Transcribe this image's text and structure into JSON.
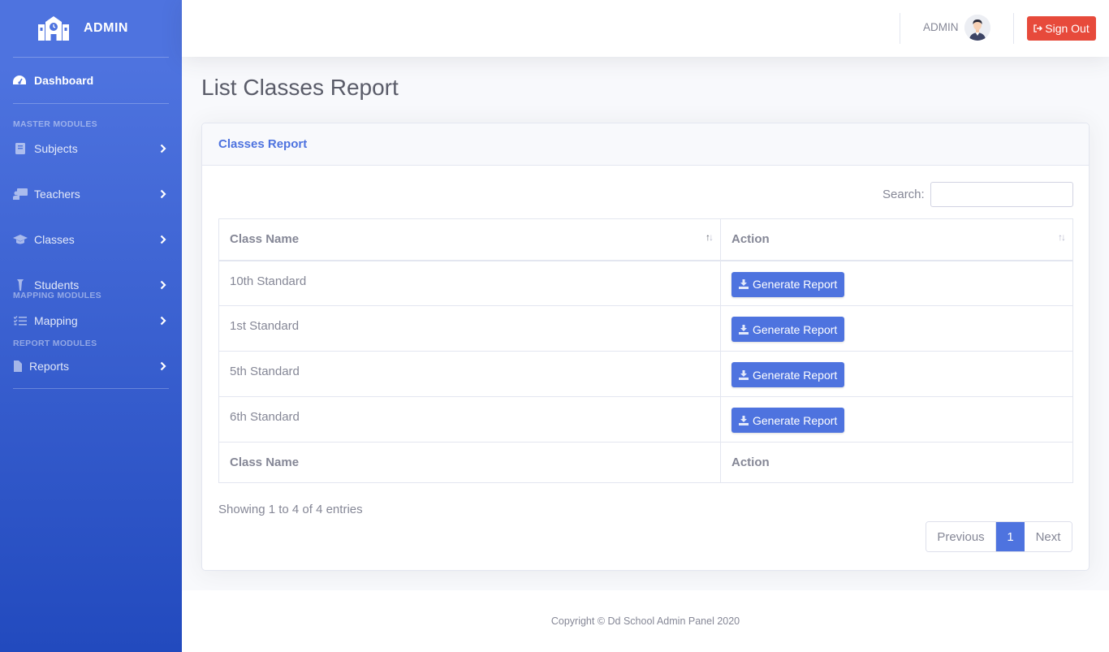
{
  "sidebar": {
    "brand": "ADMIN",
    "dashboard": "Dashboard",
    "sections": {
      "master": "MASTER MODULES",
      "mapping": "MAPPING MODULES",
      "report": "REPORT MODULES"
    },
    "items": [
      {
        "label": "Subjects",
        "icon": "book-icon"
      },
      {
        "label": "Teachers",
        "icon": "chalkboard-teacher-icon"
      },
      {
        "label": "Classes",
        "icon": "graduation-cap-icon"
      },
      {
        "label": "Students",
        "icon": "user-tie-icon"
      },
      {
        "label": "Mapping",
        "icon": "list-check-icon"
      },
      {
        "label": "Reports",
        "icon": "file-icon"
      }
    ]
  },
  "topbar": {
    "user": "ADMIN",
    "signout": "Sign Out"
  },
  "page": {
    "title": "List Classes Report"
  },
  "card": {
    "header": "Classes Report",
    "search_label": "Search:",
    "search_value": "",
    "columns": [
      "Class Name",
      "Action"
    ],
    "rows": [
      {
        "class_name": "10th Standard",
        "action": "Generate Report"
      },
      {
        "class_name": "1st Standard",
        "action": "Generate Report"
      },
      {
        "class_name": "5th Standard",
        "action": "Generate Report"
      },
      {
        "class_name": "6th Standard",
        "action": "Generate Report"
      }
    ],
    "info": "Showing 1 to 4 of 4 entries",
    "pagination": {
      "previous": "Previous",
      "current": "1",
      "next": "Next"
    }
  },
  "footer": {
    "text": "Copyright © Dd School Admin Panel 2020"
  },
  "colors": {
    "primary": "#4e73df",
    "danger": "#e74a3b",
    "text": "#858796"
  }
}
